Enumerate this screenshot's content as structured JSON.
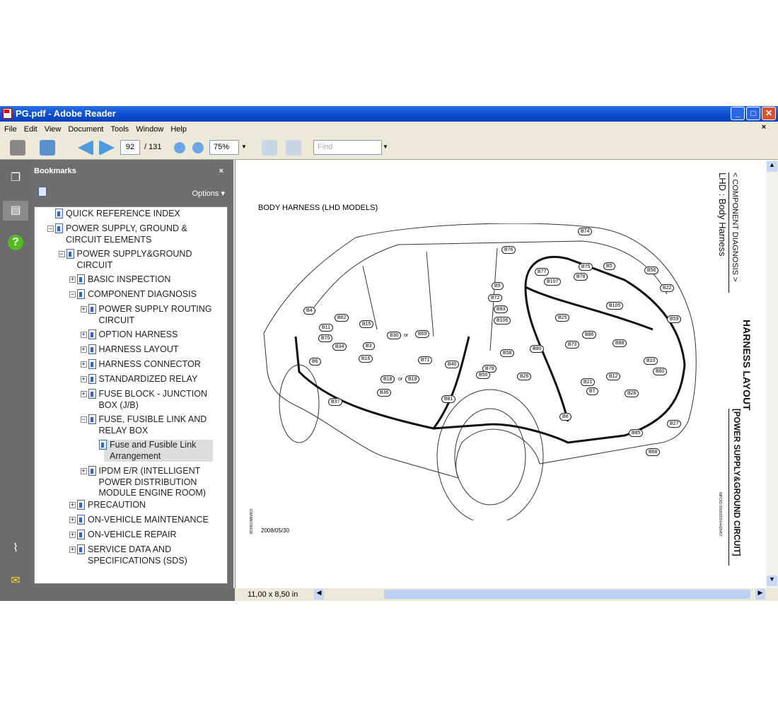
{
  "window": {
    "title": "PG.pdf - Adobe Reader"
  },
  "menu": [
    "File",
    "Edit",
    "View",
    "Document",
    "Tools",
    "Window",
    "Help"
  ],
  "toolbar": {
    "page": "92",
    "page_total": "/ 131",
    "zoom": "75%",
    "find_placeholder": "Find"
  },
  "bookmarks": {
    "title": "Bookmarks",
    "close": "×",
    "options": "Options",
    "items": [
      {
        "label": "QUICK REFERENCE INDEX",
        "toggle": ""
      },
      {
        "label": "POWER SUPPLY, GROUND & CIRCUIT ELEMENTS",
        "toggle": "−"
      },
      {
        "label": "POWER SUPPLY&GROUND CIRCUIT",
        "toggle": "−"
      },
      {
        "label": "BASIC INSPECTION",
        "toggle": "+"
      },
      {
        "label": "COMPONENT DIAGNOSIS",
        "toggle": "−"
      },
      {
        "label": "POWER SUPPLY ROUTING CIRCUIT",
        "toggle": "+"
      },
      {
        "label": "OPTION HARNESS",
        "toggle": "+"
      },
      {
        "label": "HARNESS LAYOUT",
        "toggle": "+"
      },
      {
        "label": "HARNESS CONNECTOR",
        "toggle": "+"
      },
      {
        "label": "STANDARDIZED RELAY",
        "toggle": "+"
      },
      {
        "label": "FUSE BLOCK - JUNCTION BOX (J/B)",
        "toggle": "+"
      },
      {
        "label": "FUSE, FUSIBLE LINK AND RELAY BOX",
        "toggle": "−"
      },
      {
        "label": "Fuse and Fusible Link Arrangement",
        "toggle": "",
        "selected": true
      },
      {
        "label": "IPDM E/R (INTELLIGENT POWER DISTRIBUTION MODULE ENGINE ROOM)",
        "toggle": "+"
      },
      {
        "label": "PRECAUTION",
        "toggle": "+"
      },
      {
        "label": "ON-VEHICLE MAINTENANCE",
        "toggle": "+"
      },
      {
        "label": "ON-VEHICLE REPAIR",
        "toggle": "+"
      },
      {
        "label": "SERVICE DATA AND SPECIFICATIONS (SDS)",
        "toggle": "+"
      }
    ]
  },
  "page": {
    "heading": "BODY HARNESS (LHD MODELS)",
    "section": "< COMPONENT DIAGNOSIS >",
    "subtitle": "LHD : Body Harness",
    "title": "HARNESS LAYOUT",
    "category": "[POWER SUPPLY&GROUND CIRCUIT]",
    "date": "2008/05/30",
    "code": "INFOID:0000000004495457",
    "fig_id": "JCMWA0380GB",
    "connectors": [
      "B74",
      "B76",
      "B77",
      "B75",
      "B5",
      "B56",
      "B107",
      "B78",
      "B9",
      "B22",
      "B72",
      "B83",
      "B105",
      "B4",
      "B62",
      "B15",
      "B25",
      "B106",
      "B59",
      "B11",
      "B70",
      "B30",
      "B69",
      "B3",
      "B34",
      "B86",
      "B73",
      "B88",
      "B58",
      "B80",
      "B6",
      "B16",
      "B71",
      "B40",
      "B79",
      "B10",
      "B60",
      "B12",
      "B50",
      "B26",
      "B21",
      "B18",
      "B19",
      "B36",
      "B7",
      "B28",
      "B37",
      "B81",
      "B8",
      "B27",
      "B85",
      "B68"
    ],
    "or": "or"
  },
  "status": {
    "page_size": "11,00 x 8,50 in"
  }
}
